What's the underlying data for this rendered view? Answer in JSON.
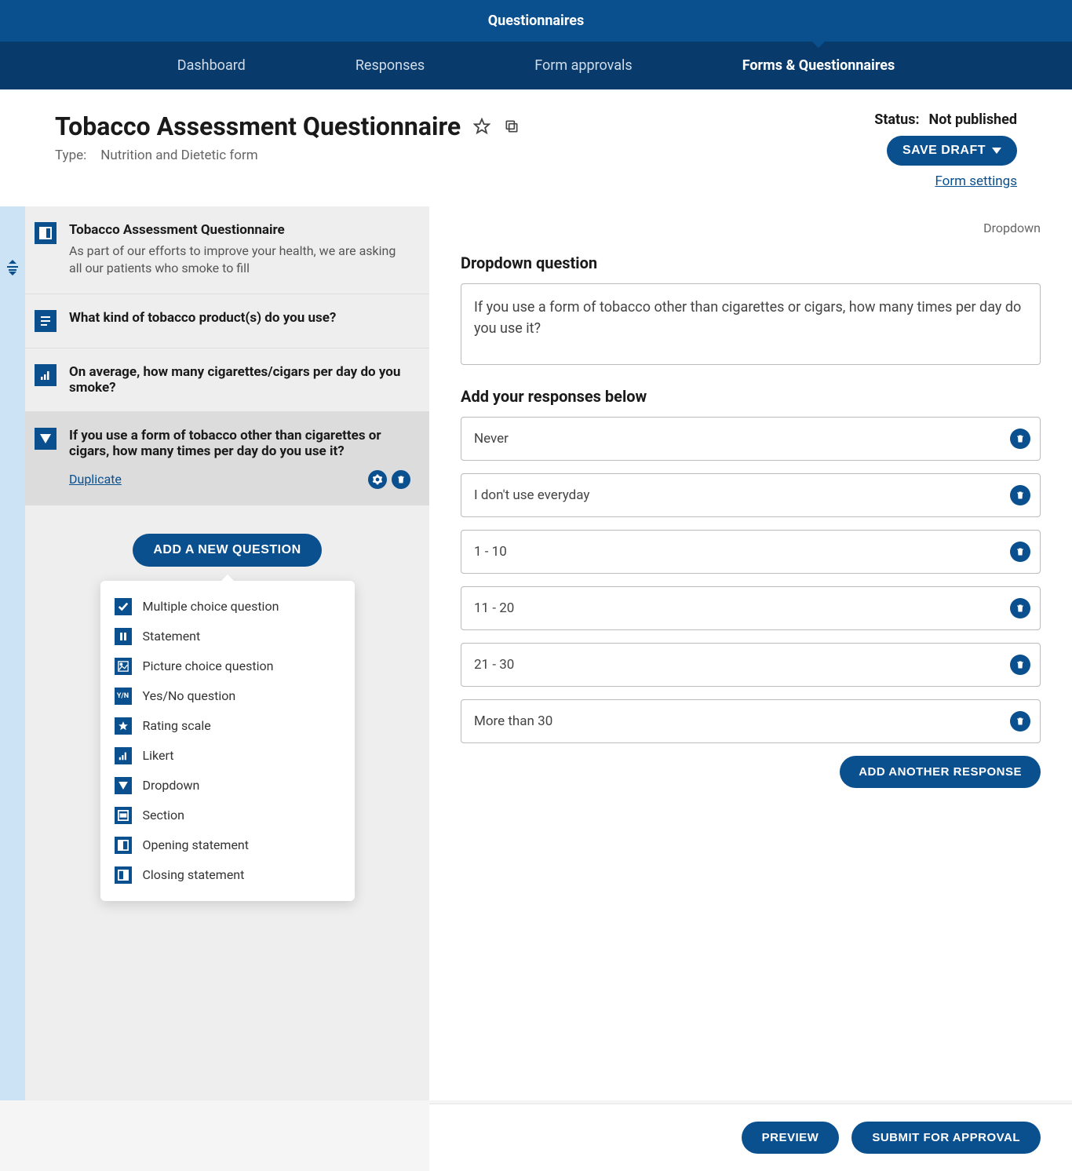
{
  "top_bar": {
    "title": "Questionnaires"
  },
  "nav": {
    "items": [
      {
        "label": "Dashboard",
        "active": false
      },
      {
        "label": "Responses",
        "active": false
      },
      {
        "label": "Form approvals",
        "active": false
      },
      {
        "label": "Forms & Questionnaires",
        "active": true
      }
    ]
  },
  "header": {
    "title": "Tobacco Assessment Questionnaire",
    "type_label": "Type:",
    "type_value": "Nutrition and Dietetic form",
    "status_label": "Status:",
    "status_value": "Not published",
    "save_draft": "SAVE DRAFT",
    "form_settings": "Form settings"
  },
  "sidebar": {
    "questions": [
      {
        "icon": "opening-statement-icon",
        "title": "Tobacco Assessment Questionnaire",
        "subtitle": "As part of our efforts to improve your health, we are asking all our patients who smoke to fill",
        "active": false
      },
      {
        "icon": "statement-icon",
        "title": "What kind of tobacco product(s) do you use?",
        "active": false
      },
      {
        "icon": "likert-icon",
        "title": "On average, how many cigarettes/cigars per day do you smoke?",
        "active": false
      },
      {
        "icon": "dropdown-icon",
        "title": "If you use a form of tobacco other than cigarettes or cigars, how many times per day do you use it?",
        "active": true,
        "duplicate": "Duplicate"
      }
    ],
    "add_button": "ADD A NEW QUESTION",
    "menu": [
      {
        "icon": "check-icon",
        "label": "Multiple choice question"
      },
      {
        "icon": "pause-icon",
        "label": "Statement"
      },
      {
        "icon": "picture-icon",
        "label": "Picture choice question"
      },
      {
        "icon": "yn-icon",
        "label": "Yes/No question"
      },
      {
        "icon": "star-icon",
        "label": "Rating scale"
      },
      {
        "icon": "bars-icon",
        "label": "Likert"
      },
      {
        "icon": "triangle-icon",
        "label": "Dropdown"
      },
      {
        "icon": "section-icon",
        "label": "Section"
      },
      {
        "icon": "opening-icon",
        "label": "Opening statement"
      },
      {
        "icon": "closing-icon",
        "label": "Closing statement"
      }
    ]
  },
  "editor": {
    "type_label": "Dropdown",
    "question_section_title": "Dropdown question",
    "question_text": "If you use a form of tobacco other than cigarettes or cigars, how many times per day do you use it?",
    "responses_title": "Add your responses below",
    "responses": [
      "Never",
      "I don't use everyday",
      "1 - 10",
      "11 - 20",
      "21 - 30",
      "More than 30"
    ],
    "add_response": "ADD ANOTHER RESPONSE"
  },
  "footer": {
    "preview": "PREVIEW",
    "submit": "SUBMIT FOR APPROVAL"
  }
}
